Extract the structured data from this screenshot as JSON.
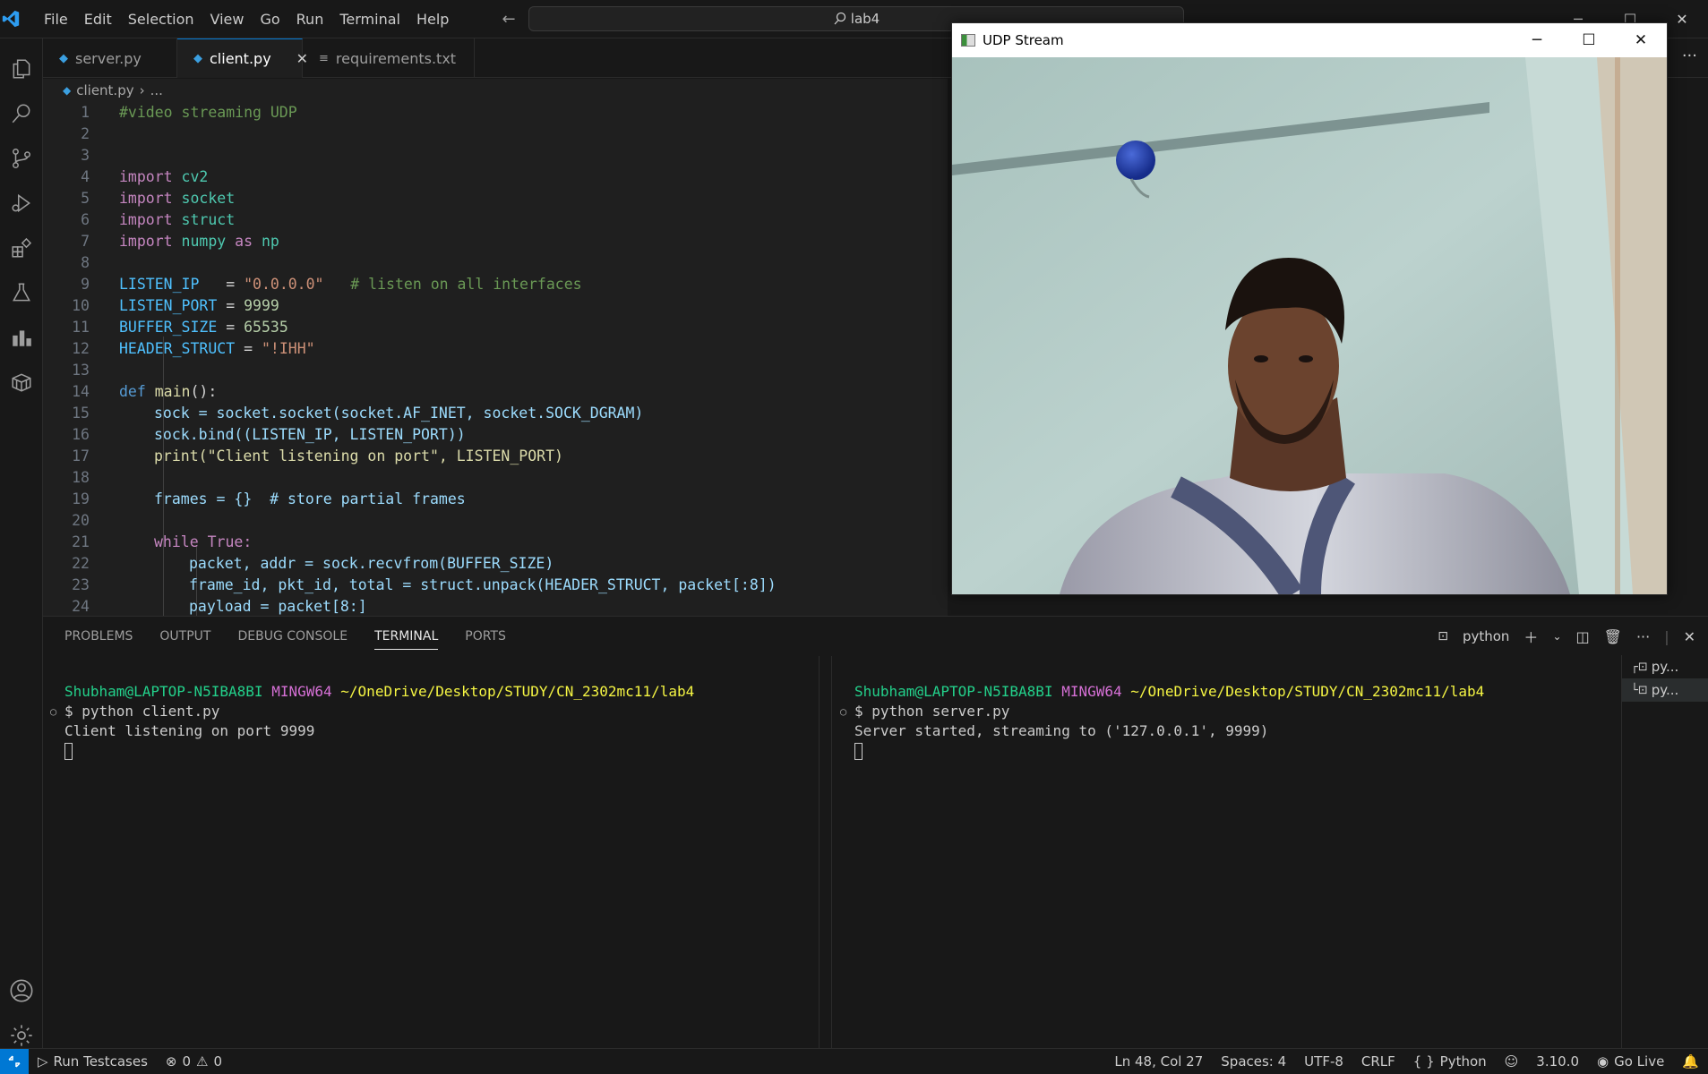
{
  "titlebar": {
    "menu": [
      "File",
      "Edit",
      "Selection",
      "View",
      "Go",
      "Run",
      "Terminal",
      "Help"
    ],
    "search_text": "lab4"
  },
  "tabs": [
    {
      "label": "server.py",
      "icon": "python-icon"
    },
    {
      "label": "client.py",
      "icon": "python-icon",
      "active": true
    },
    {
      "label": "requirements.txt",
      "icon": "text-file-icon"
    }
  ],
  "breadcrumb": {
    "file": "client.py",
    "rest": "..."
  },
  "editor": {
    "line_numbers": [
      "1",
      "2",
      "3",
      "4",
      "5",
      "6",
      "7",
      "8",
      "9",
      "10",
      "11",
      "12",
      "13",
      "14",
      "15",
      "16",
      "17",
      "18",
      "19",
      "20",
      "21",
      "22",
      "23",
      "24"
    ]
  },
  "code": {
    "l1": "#video streaming UDP",
    "l4a": "import",
    "l4b": "cv2",
    "l5a": "import",
    "l5b": "socket",
    "l6a": "import",
    "l6b": "struct",
    "l7a": "import",
    "l7b": "numpy",
    "l7c": "as",
    "l7d": "np",
    "l9a": "LISTEN_IP",
    "l9b": "   = ",
    "l9c": "\"0.0.0.0\"",
    "l9d": "   # listen on all interfaces",
    "l10a": "LISTEN_PORT",
    "l10b": " = ",
    "l10c": "9999",
    "l11a": "BUFFER_SIZE",
    "l11b": " = ",
    "l11c": "65535",
    "l12a": "HEADER_STRUCT",
    "l12b": " = ",
    "l12c": "\"!IHH\"",
    "l14a": "def",
    "l14b": "main",
    "l14c": "():",
    "l15": "sock = socket.socket(socket.AF_INET, socket.SOCK_DGRAM)",
    "l16": "sock.bind((LISTEN_IP, LISTEN_PORT))",
    "l17": "print(\"Client listening on port\", LISTEN_PORT)",
    "l19": "frames = {}  # store partial frames",
    "l21": "while True:",
    "l22": "packet, addr = sock.recvfrom(BUFFER_SIZE)",
    "l23": "frame_id, pkt_id, total = struct.unpack(HEADER_STRUCT, packet[:8])",
    "l24": "payload = packet[8:]"
  },
  "udp_window": {
    "title": "UDP Stream"
  },
  "panel": {
    "tabs": [
      "PROBLEMS",
      "OUTPUT",
      "DEBUG CONSOLE",
      "TERMINAL",
      "PORTS"
    ],
    "active_tab": "TERMINAL",
    "shell_label": "python"
  },
  "terminal_left": {
    "user": "Shubham@LAPTOP-N5IBA8BI",
    "env": "MINGW64",
    "path": "~/OneDrive/Desktop/STUDY/CN_2302mc11/lab4",
    "cmd": "$ python client.py",
    "out": "Client listening on port 9999"
  },
  "terminal_right": {
    "user": "Shubham@LAPTOP-N5IBA8BI",
    "env": "MINGW64",
    "path": "~/OneDrive/Desktop/STUDY/CN_2302mc11/lab4",
    "cmd": "$ python server.py",
    "out": "Server started, streaming to ('127.0.0.1', 9999)"
  },
  "terminal_list": [
    "py...",
    "py..."
  ],
  "statusbar": {
    "run_testcases": "Run Testcases",
    "errors": "0",
    "warnings": "0",
    "position": "Ln 48, Col 27",
    "spaces": "Spaces: 4",
    "encoding": "UTF-8",
    "eol": "CRLF",
    "language": "Python",
    "version": "3.10.0",
    "golive": "Go Live"
  },
  "colors": {
    "accent": "#0078d4",
    "background": "#181818",
    "editor": "#1f1f1f"
  }
}
